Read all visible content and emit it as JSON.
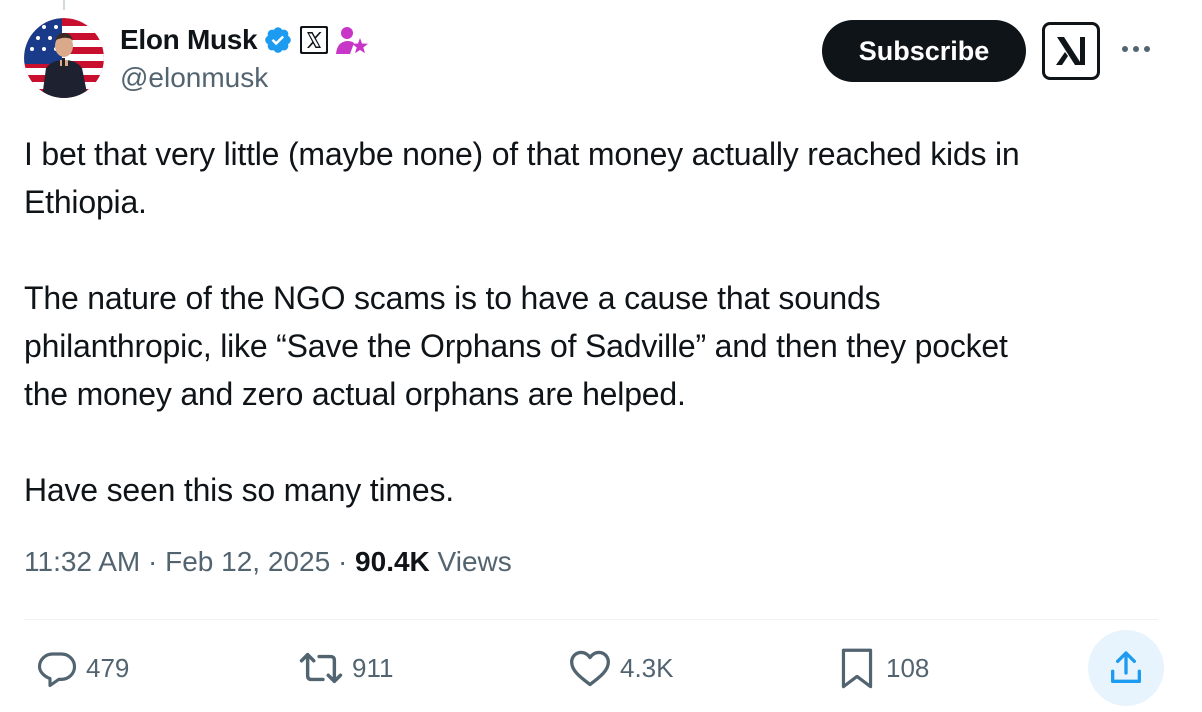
{
  "author": {
    "display_name": "Elon Musk",
    "handle": "@elonmusk",
    "verified_icon": "verified-badge-icon",
    "affiliate_icon": "x-logo-badge-icon",
    "gov_icon": "person-star-badge-icon"
  },
  "buttons": {
    "subscribe_label": "Subscribe",
    "grok_icon": "grok-icon",
    "more_icon": "more-dots-icon"
  },
  "tweet": {
    "text": "I bet that very little (maybe none) of that money actually reached kids in\nEthiopia.\n\nThe nature of the NGO scams is to have a cause that sounds\nphilanthropic, like “Save the Orphans of Sadville” and then they pocket\nthe money and zero actual orphans are helped.\n\nHave seen this so many times.",
    "time": "11:32 AM",
    "separator": "·",
    "date": "Feb 12, 2025",
    "views_count": "90.4K",
    "views_label": "Views"
  },
  "actions": {
    "replies": "479",
    "reposts": "911",
    "likes": "4.3K",
    "bookmarks": "108"
  },
  "colors": {
    "text": "#0f1419",
    "secondary": "#536471",
    "verified": "#1d9bf0",
    "badge_purple": "#c836c8",
    "share_bg": "#e8f4fd"
  }
}
